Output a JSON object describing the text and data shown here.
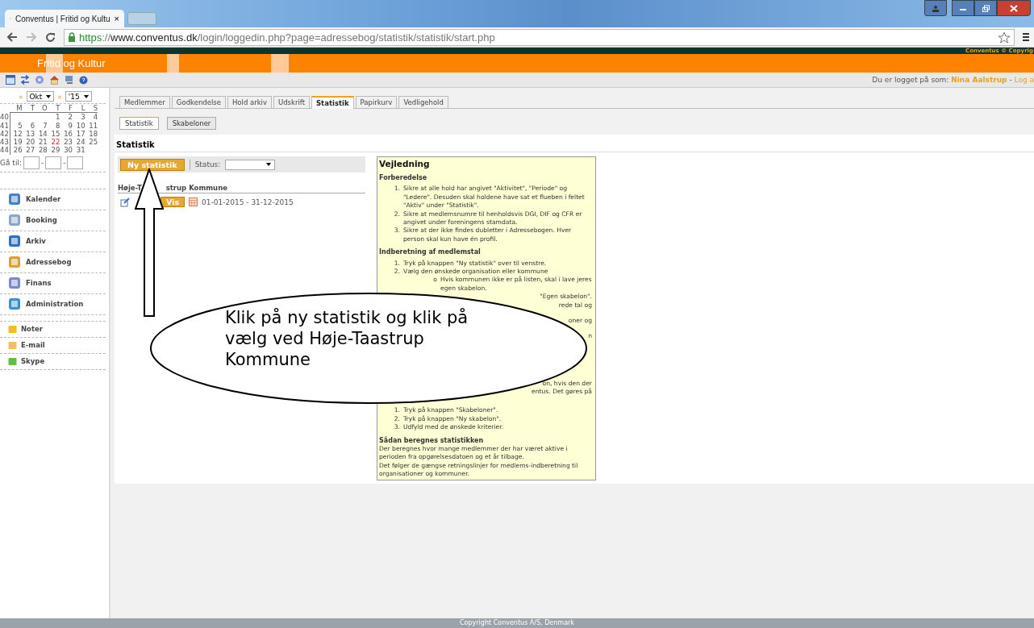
{
  "browser": {
    "tab_title": "Conventus | Fritid og Kultu",
    "tab_close": "×",
    "url": {
      "scheme": "https",
      "separator": "://",
      "host": "www.conventus.dk",
      "path": "/login/loggedin.php?page=adressebog/statistik/statistik/start.php"
    }
  },
  "banner": {
    "copyright": "Conventus © Copyrig",
    "title": "Fritid og Kultur"
  },
  "toolbar": {
    "login_label": "Du er logget på som:",
    "user": "Nina Aalstrup",
    "separator": "-",
    "logout": "Log a"
  },
  "calendar": {
    "prev": "«",
    "month": "Okt",
    "next": "»",
    "year": "'15",
    "weekdays": [
      "M",
      "T",
      "O",
      "T",
      "F",
      "L",
      "S"
    ],
    "weeks": [
      {
        "number": "40",
        "days": [
          {
            "d": "1",
            "today": false
          },
          {
            "d": "2",
            "today": false
          },
          {
            "d": "3",
            "today": false
          },
          {
            "d": "4",
            "today": false
          }
        ]
      },
      {
        "number": "41",
        "days": [
          {
            "d": "5",
            "today": false
          },
          {
            "d": "6",
            "today": false
          },
          {
            "d": "7",
            "today": false
          },
          {
            "d": "8",
            "today": false
          },
          {
            "d": "9",
            "today": false
          },
          {
            "d": "10",
            "today": false
          },
          {
            "d": "11",
            "today": false
          }
        ]
      },
      {
        "number": "42",
        "days": [
          {
            "d": "12",
            "today": false
          },
          {
            "d": "13",
            "today": false
          },
          {
            "d": "14",
            "today": false
          },
          {
            "d": "15",
            "today": false
          },
          {
            "d": "16",
            "today": false
          },
          {
            "d": "17",
            "today": false
          },
          {
            "d": "18",
            "today": false
          }
        ]
      },
      {
        "number": "43",
        "days": [
          {
            "d": "19",
            "today": false
          },
          {
            "d": "20",
            "today": false
          },
          {
            "d": "21",
            "today": false
          },
          {
            "d": "22",
            "today": true
          },
          {
            "d": "23",
            "today": false
          },
          {
            "d": "24",
            "today": false
          },
          {
            "d": "25",
            "today": false
          }
        ]
      },
      {
        "number": "44",
        "days": [
          {
            "d": "26",
            "today": false
          },
          {
            "d": "27",
            "today": false
          },
          {
            "d": "28",
            "today": false
          },
          {
            "d": "29",
            "today": false
          },
          {
            "d": "30",
            "today": false
          },
          {
            "d": "31",
            "today": false
          }
        ]
      }
    ],
    "goto_label": "Gå til:",
    "goto_separators": [
      "-",
      "-"
    ]
  },
  "nav": [
    "Kalender",
    "Booking",
    "Arkiv",
    "Adressebog",
    "Finans",
    "Administration"
  ],
  "shortcuts": [
    "Noter",
    "E-mail",
    "Skype"
  ],
  "tabs": [
    {
      "label": "Medlemmer",
      "selected": false
    },
    {
      "label": "Godkendelse",
      "selected": false
    },
    {
      "label": "Hold arkiv",
      "selected": false
    },
    {
      "label": "Udskrift",
      "selected": false
    },
    {
      "label": "Statistik",
      "selected": true
    },
    {
      "label": "Papirkurv",
      "selected": false
    },
    {
      "label": "Vedligehold",
      "selected": false
    }
  ],
  "subtabs": [
    {
      "label": "Statistik",
      "selected": true
    },
    {
      "label": "Skabeloner",
      "selected": false
    }
  ],
  "heading": "Statistik",
  "actions": {
    "new_button": "Ny statistik",
    "status_label": "Status:"
  },
  "group": {
    "title_parts": [
      "Høje-T",
      "strup Kommune"
    ],
    "rows": [
      {
        "button": "Vis",
        "period": "01-01-2015 - 31-12-2015"
      }
    ]
  },
  "guide": {
    "title": "Vejledning",
    "blocks": [
      {
        "kind": "subheading",
        "text": "Forberedelse"
      },
      {
        "kind": "list",
        "items": [
          {
            "marker": "1.",
            "text": "Sikre at alle hold har angivet \"Aktivitet\", \"Periode\" og \"Ledere\". Desuden skal holdene have sat et flueben i feltet \"Aktiv\" under \"Statistik\"."
          },
          {
            "marker": "2.",
            "text": "Sikre at medlemsnumre til henholdsvis DGI, DIF og CFR er angivet under foreningens stamdata."
          },
          {
            "marker": "3.",
            "text": "Sikre at der ikke findes dubletter i Adressebogen. Hver person skal kun have én profil."
          }
        ]
      },
      {
        "kind": "subheading",
        "text": "Indberetning af medlemstal"
      },
      {
        "kind": "list",
        "items": [
          {
            "marker": "1.",
            "text": "Tryk på knappen \"Ny statistik\" over til venstre."
          },
          {
            "marker": "2.",
            "text": "Vælg den ønskede organisation eller kommune"
          }
        ]
      },
      {
        "kind": "bullets",
        "items": [
          {
            "marker": "o",
            "text": "Hvis kommunen ikke er på listen, skal i lave jeres egen skabelon."
          }
        ]
      },
      {
        "kind": "fragments",
        "items": [
          "\"Egen skabelon\".",
          "rede tal og",
          "oner og",
          "n",
          "on, hvis den der",
          "entus. Det gøres på"
        ]
      },
      {
        "kind": "list",
        "items": [
          {
            "marker": "1.",
            "text": "Tryk på knappen \"Skabeloner\"."
          },
          {
            "marker": "2.",
            "text": "Tryk på knappen \"Ny skabelon\"."
          },
          {
            "marker": "3.",
            "text": "Udfyld med de ønskede kriterier."
          }
        ]
      },
      {
        "kind": "subheading",
        "text": "Sådan beregnes statistikken"
      },
      {
        "kind": "paragraph",
        "text": "Der beregnes hvor mange medlemmer der har været aktive i perioden fra opgørelsesdatoen og et år tilbage."
      },
      {
        "kind": "paragraph",
        "text": "Det følger de gængse retningslinjer for medlems-indberetning til organisationer og kommuner."
      }
    ]
  },
  "callout": {
    "text": "Klik på ny statistik og klik på vælg ved Høje-Taastrup Kommune"
  },
  "footer": "Copyright Conventus A/S, Denmark"
}
